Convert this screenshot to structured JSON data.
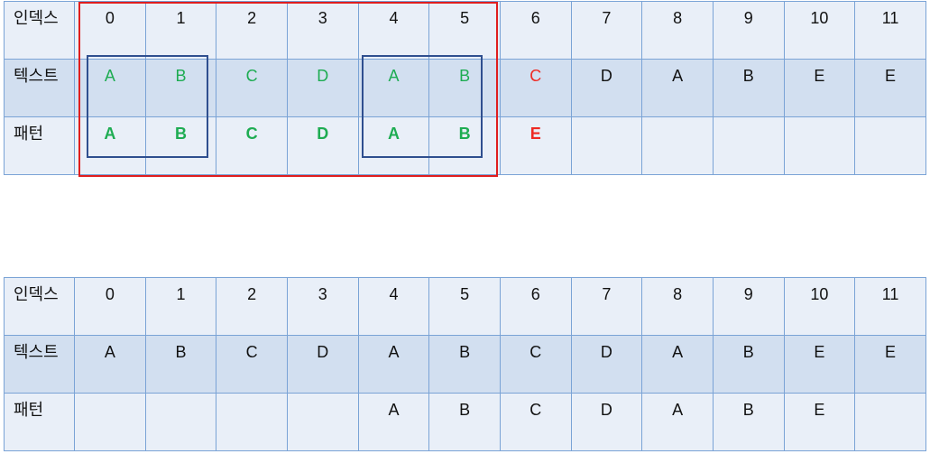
{
  "labels": {
    "index": "인덱스",
    "text": "텍스트",
    "pattern": "패턴"
  },
  "indices": [
    "0",
    "1",
    "2",
    "3",
    "4",
    "5",
    "6",
    "7",
    "8",
    "9",
    "10",
    "11"
  ],
  "text": [
    "A",
    "B",
    "C",
    "D",
    "A",
    "B",
    "C",
    "D",
    "A",
    "B",
    "E",
    "E"
  ],
  "top_pattern": [
    "A",
    "B",
    "C",
    "D",
    "A",
    "B",
    "E",
    "",
    "",
    "",
    "",
    ""
  ],
  "bottom_pattern": [
    "",
    "",
    "",
    "",
    "A",
    "B",
    "C",
    "D",
    "A",
    "B",
    "E",
    ""
  ],
  "colors": {
    "match": "#1eac52",
    "mismatch": "#ee2a24",
    "window": "#e01e1e",
    "border_box": "#2f4f8f",
    "grid": "#7aa3d6"
  }
}
